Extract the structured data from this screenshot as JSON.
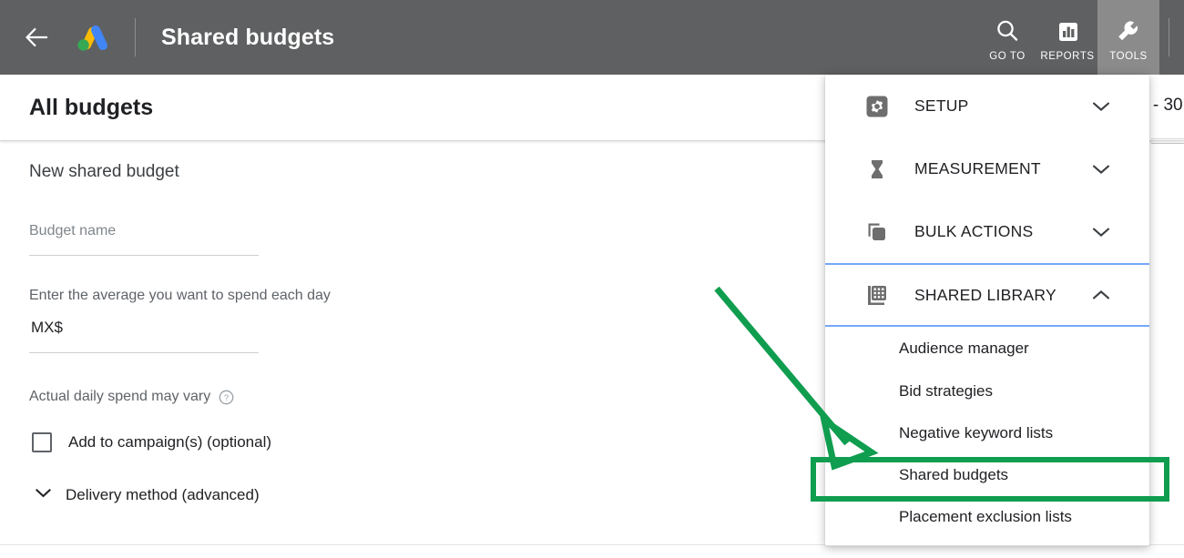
{
  "header": {
    "back_icon": "back-arrow-icon",
    "logo": "google-ads-logo",
    "title": "Shared budgets",
    "actions": [
      {
        "label": "GO TO",
        "icon": "search-icon",
        "active": false
      },
      {
        "label": "REPORTS",
        "icon": "bar-chart-icon",
        "active": false
      },
      {
        "label": "TOOLS",
        "icon": "wrench-icon",
        "active": true
      }
    ]
  },
  "page": {
    "section_title": "All budgets",
    "background_date_range": "4 - 30"
  },
  "form": {
    "heading": "New shared budget",
    "budget_name": {
      "placeholder": "Budget name",
      "value": ""
    },
    "average_spend_label": "Enter the average you want to spend each day",
    "currency": {
      "prefix": "MX$",
      "value": ""
    },
    "vary_note": "Actual daily spend may vary",
    "vary_help_icon": "help-circle-icon",
    "add_to_campaigns": {
      "label": "Add to campaign(s) (optional)",
      "checked": false
    },
    "delivery_method": {
      "label": "Delivery method (advanced)",
      "expanded": false,
      "chevron_icon": "chevron-down-icon"
    }
  },
  "tools_menu": {
    "sections": [
      {
        "label": "SETUP",
        "icon": "gear-icon",
        "expanded": false,
        "chevron": "chevron-down-icon"
      },
      {
        "label": "MEASUREMENT",
        "icon": "hourglass-icon",
        "expanded": false,
        "chevron": "chevron-down-icon"
      },
      {
        "label": "BULK ACTIONS",
        "icon": "copy-stack-icon",
        "expanded": false,
        "chevron": "chevron-down-icon"
      },
      {
        "label": "SHARED LIBRARY",
        "icon": "grid-library-icon",
        "expanded": true,
        "chevron": "chevron-up-icon"
      }
    ],
    "shared_library_items": [
      {
        "label": "Audience manager",
        "highlighted": false
      },
      {
        "label": "Bid strategies",
        "highlighted": false
      },
      {
        "label": "Negative keyword lists",
        "highlighted": false
      },
      {
        "label": "Shared budgets",
        "highlighted": true
      },
      {
        "label": "Placement exclusion lists",
        "highlighted": false
      }
    ]
  },
  "annotations": {
    "arrow": {
      "name": "green-pointer-arrow",
      "color": "#0f9d4f"
    },
    "highlight_box": {
      "name": "green-highlight-box",
      "color": "#0f9d4f",
      "target": "Shared budgets"
    }
  },
  "colors": {
    "header_bg": "#5f6061",
    "tools_active_bg": "#8b8b8b",
    "expanded_border": "#74a8f7",
    "annotation_green": "#0f9d4f",
    "logo_yellow": "#fbbc04",
    "logo_blue": "#4285f4",
    "logo_green": "#34a853"
  }
}
